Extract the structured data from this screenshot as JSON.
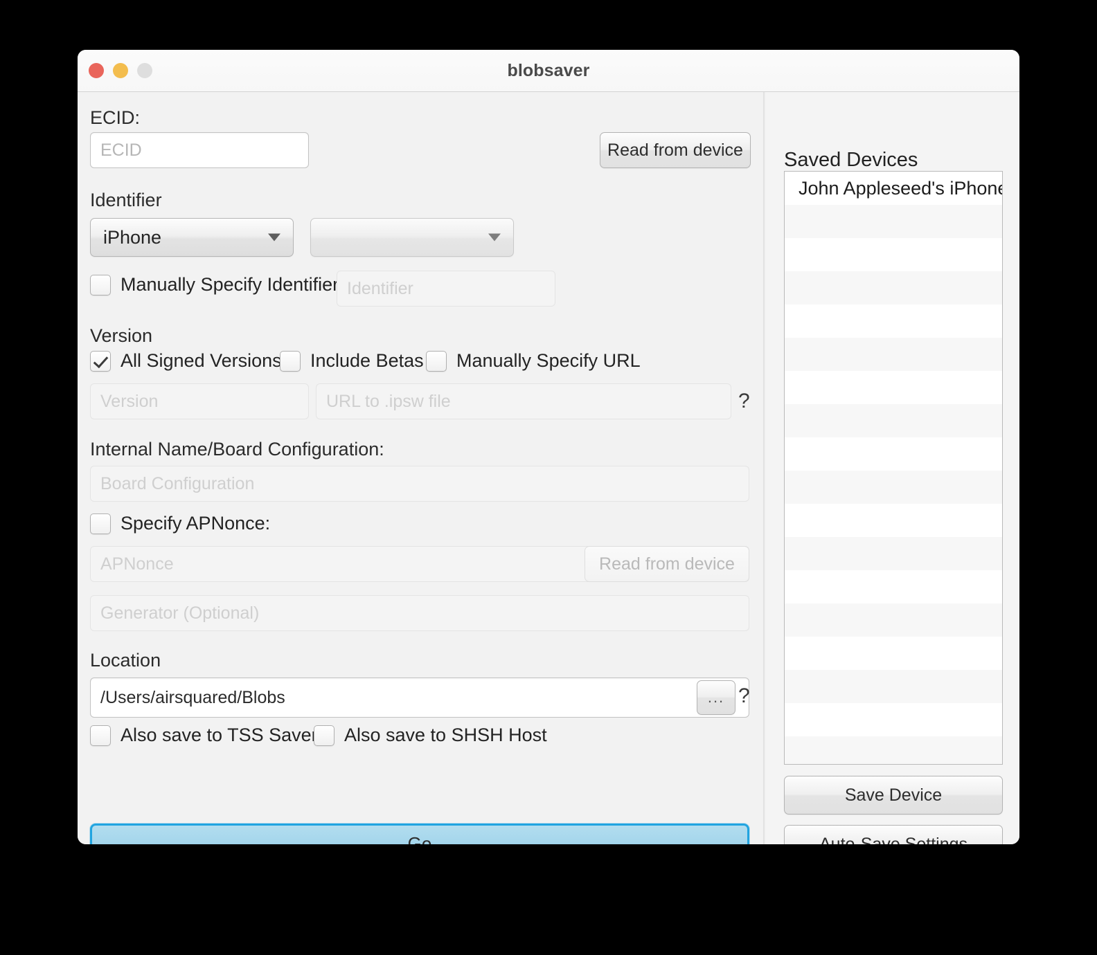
{
  "window": {
    "title": "blobsaver",
    "traffic_lights": {
      "close": "close-button",
      "minimize": "minimize-button",
      "zoom": "zoom-button"
    },
    "colors": {
      "close": "#e9655b",
      "minimize": "#f3bd4e",
      "zoom": "#dedede",
      "accent_focus_ring": "#21a4e0",
      "go_button_fill": "#a5d6ec",
      "window_background": "#f2f2f2",
      "panel_background": "#f4f4f4"
    }
  },
  "main": {
    "ecid": {
      "label": "ECID:",
      "value": "",
      "placeholder": "ECID",
      "read_button": "Read from device"
    },
    "identifier": {
      "label": "Identifier",
      "device_type_selected": "iPhone",
      "device_model_selected": "",
      "manual_checkbox_label": "Manually Specify Identifier:",
      "manual_checked": false,
      "manual_value": "",
      "manual_placeholder": "Identifier"
    },
    "version": {
      "label": "Version",
      "all_signed_label": "All Signed Versions",
      "all_signed_checked": true,
      "include_betas_label": "Include Betas",
      "include_betas_checked": false,
      "manual_url_label": "Manually Specify URL",
      "manual_url_checked": false,
      "version_value": "",
      "version_placeholder": "Version",
      "url_value": "",
      "url_placeholder": "URL to .ipsw file",
      "help": "?"
    },
    "board": {
      "label": "Internal Name/Board Configuration:",
      "value": "",
      "placeholder": "Board Configuration"
    },
    "apnonce": {
      "checkbox_label": "Specify APNonce:",
      "checked": false,
      "value": "",
      "placeholder": "APNonce",
      "read_button": "Read from device",
      "generator_value": "",
      "generator_placeholder": "Generator (Optional)"
    },
    "location": {
      "label": "Location",
      "value": "/Users/airsquared/Blobs",
      "browse_button": "...",
      "help": "?",
      "tss_saver_label": "Also save to TSS Saver",
      "tss_saver_checked": false,
      "shsh_host_label": "Also save to SHSH Host",
      "shsh_host_checked": false
    },
    "go_button": "Go"
  },
  "sidebar": {
    "title": "Saved Devices",
    "devices": [
      "John Appleseed's iPhone"
    ],
    "empty_row_count": 17,
    "save_device_button": "Save Device",
    "auto_save_button": "Auto-Save Settings"
  }
}
